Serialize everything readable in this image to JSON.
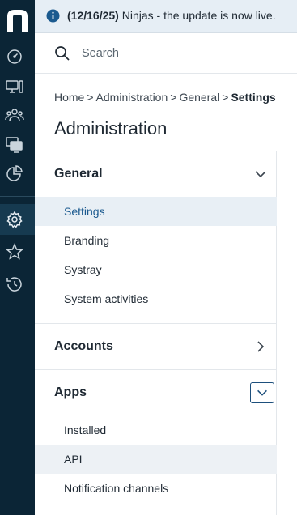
{
  "banner": {
    "date": "(12/16/25)",
    "message": "Ninjas - the update is now live."
  },
  "search": {
    "placeholder": "Search"
  },
  "breadcrumb": {
    "items": [
      "Home",
      "Administration",
      "General"
    ],
    "current": "Settings",
    "separator": ">"
  },
  "page": {
    "title": "Administration"
  },
  "nav": {
    "groups": [
      {
        "label": "General",
        "expanded": true,
        "items": [
          {
            "label": "Settings",
            "selected": true
          },
          {
            "label": "Branding"
          },
          {
            "label": "Systray"
          },
          {
            "label": "System activities"
          }
        ]
      },
      {
        "label": "Accounts",
        "expanded": false,
        "items": []
      },
      {
        "label": "Apps",
        "expanded": true,
        "items": [
          {
            "label": "Installed"
          },
          {
            "label": "API"
          },
          {
            "label": "Notification channels"
          }
        ]
      }
    ]
  },
  "rail": {
    "icons": [
      "ninjaone-logo",
      "dashboard-gauge-icon",
      "devices-icon",
      "users-icon",
      "remote-screens-icon",
      "reports-pie-icon",
      "settings-gear-icon",
      "favorites-star-icon",
      "history-icon"
    ],
    "active": "settings-gear-icon"
  },
  "colors": {
    "rail_bg": "#0b2536",
    "banner_bg": "#e6eef5",
    "selected_bg": "#e8eff5",
    "accent": "#1b5a8f"
  }
}
